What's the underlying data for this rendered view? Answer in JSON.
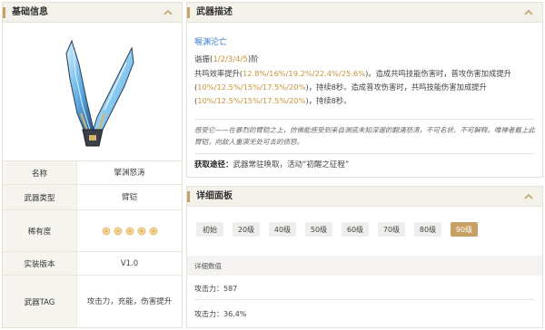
{
  "basic": {
    "title": "基础信息",
    "rows": [
      {
        "key": "名称",
        "value": "擎渊怒涛"
      },
      {
        "key": "武器类型",
        "value": "臂铠"
      },
      {
        "key": "稀有度",
        "value": "",
        "stars": 5
      },
      {
        "key": "实装版本",
        "value": "V1.0"
      },
      {
        "key": "武器TAG",
        "value": "攻击力，充能，伤害提升"
      }
    ]
  },
  "desc": {
    "title": "武器描述",
    "weapon_name": "喔渊沦亡",
    "refine_prefix": "谐振(",
    "refine_levels": "1/2/3/4/5",
    "refine_suffix": ")阶",
    "effect": {
      "p1": "共鸣效率提升(",
      "v1": "12.8%/16%/19.2%/22.4%/25.6%",
      "p2": ")。造成共鸣技能伤害时，普攻伤害加成提升(",
      "v2": "10%/12.5%/15%/17.5%/20%",
      "p3": ")，持续8秒。造成普攻伤害时，共鸣技能伤害加成提升(",
      "v3": "10%/12.5%/15%/17.5%/20%",
      "p4": ")，持续8秒。"
    },
    "story": "感受它——在暴烈的臂铠之上，仿佛能感受到来自渊底未知深邃的翻涌怒涛，不可名状、不可解释。唯禅者戴上此臂铠，向敌人重演无处可去的债怒。",
    "get_label": "获取途径：",
    "get_value": "武器常驻唤取，活动“初醒之征程”"
  },
  "detail": {
    "title": "详细面板",
    "levels": [
      "初始",
      "20级",
      "40级",
      "50级",
      "60级",
      "70级",
      "80级",
      "90级"
    ],
    "active_level": "90级",
    "stat_header": "详细数值",
    "stats": [
      "攻击力：587",
      "攻击力：36.4%"
    ]
  },
  "colors": {
    "accent": "#c8a063",
    "link": "#3a7ac8",
    "highlight": "#c8933a"
  }
}
